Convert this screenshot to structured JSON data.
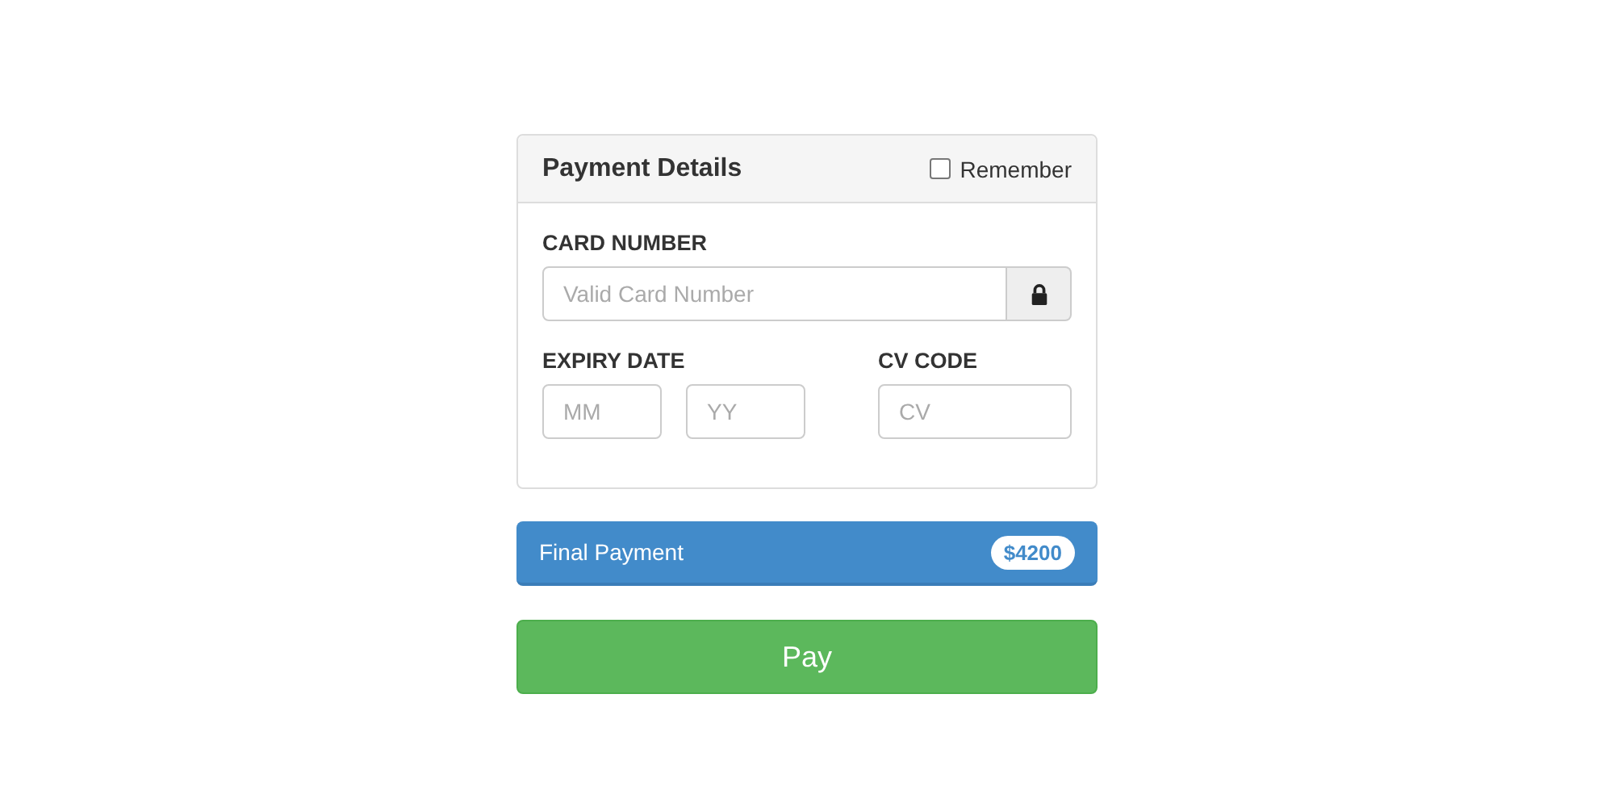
{
  "panel": {
    "title": "Payment Details",
    "remember": {
      "label": "Remember",
      "checked": false
    }
  },
  "card_number": {
    "label": "CARD NUMBER",
    "placeholder": "Valid Card Number"
  },
  "expiry": {
    "label": "EXPIRY DATE",
    "month_placeholder": "MM",
    "year_placeholder": "YY"
  },
  "cv": {
    "label": "CV CODE",
    "placeholder": "CV"
  },
  "final_payment": {
    "label": "Final Payment",
    "amount": "$4200"
  },
  "pay_button": "Pay"
}
